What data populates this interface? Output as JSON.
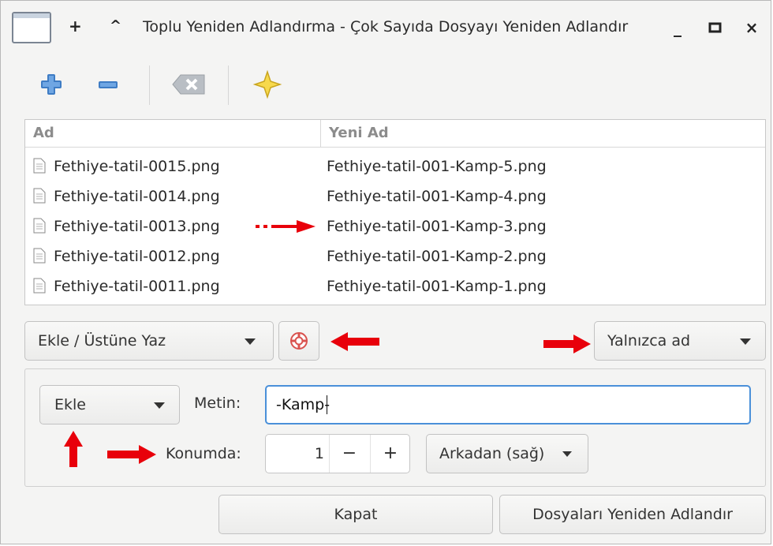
{
  "window": {
    "title": "Toplu Yeniden Adlandırma - Çok Sayıda Dosyayı Yeniden Adlandır",
    "titlebar_buttons": {
      "add": "+",
      "collapse": "^"
    },
    "controls": {
      "minimize": "_",
      "maximize": "▫",
      "close": "×"
    }
  },
  "toolbar": {
    "icons": [
      "add-icon",
      "remove-icon",
      "clear-icon",
      "star-icon"
    ]
  },
  "list": {
    "headers": {
      "name": "Ad",
      "new_name": "Yeni Ad"
    },
    "rows": [
      {
        "old": "Fethiye-tatil-0015.png",
        "new": "Fethiye-tatil-001-Kamp-5.png"
      },
      {
        "old": "Fethiye-tatil-0014.png",
        "new": "Fethiye-tatil-001-Kamp-4.png"
      },
      {
        "old": "Fethiye-tatil-0013.png",
        "new": "Fethiye-tatil-001-Kamp-3.png"
      },
      {
        "old": "Fethiye-tatil-0012.png",
        "new": "Fethiye-tatil-001-Kamp-2.png"
      },
      {
        "old": "Fethiye-tatil-0011.png",
        "new": "Fethiye-tatil-001-Kamp-1.png"
      }
    ]
  },
  "mode": {
    "selected": "Ekle / Üstüne Yaz"
  },
  "scope": {
    "selected": "Yalnızca ad"
  },
  "panel": {
    "action_selected": "Ekle",
    "text_label": "Metin:",
    "text_value": "-Kamp-",
    "position_label": "Konumda:",
    "position_value": "1",
    "minus": "−",
    "plus": "+",
    "direction_selected": "Arkadan (sağ)"
  },
  "footer": {
    "close": "Kapat",
    "rename": "Dosyaları Yeniden Adlandır"
  },
  "colors": {
    "accent": "#4a90d9",
    "annotation": "#e8000b"
  }
}
